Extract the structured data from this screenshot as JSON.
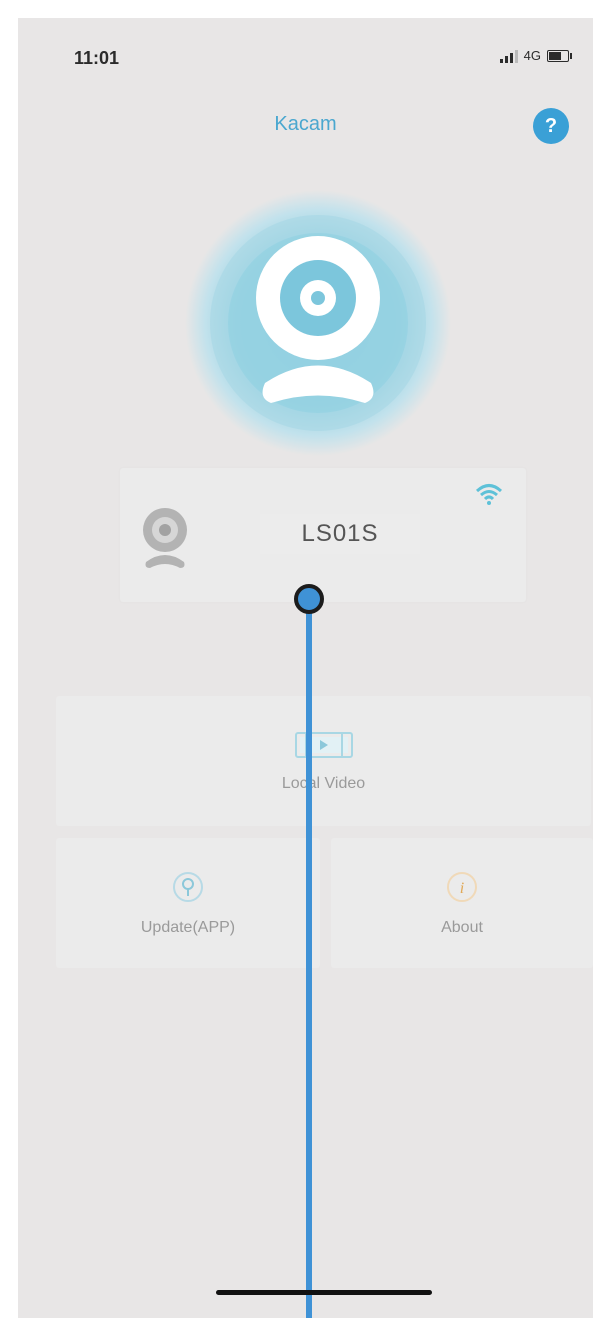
{
  "status_bar": {
    "time": "11:01",
    "network": "4G"
  },
  "nav": {
    "title": "Kacam",
    "help_label": "?"
  },
  "device": {
    "name": "LS01S"
  },
  "tiles": {
    "local_video": "Local Video",
    "update": "Update(APP)",
    "about": "About"
  },
  "colors": {
    "accent": "#4aa7cf",
    "background": "#e8e6e6",
    "tile": "#ebebeb",
    "pointer": "#3f92d6"
  },
  "icons": {
    "help": "help-icon",
    "camera_hero": "webcam-icon",
    "device_thumb": "webcam-icon",
    "wifi": "wifi-icon",
    "local_video": "video-file-icon",
    "update": "update-icon",
    "about": "info-icon"
  }
}
